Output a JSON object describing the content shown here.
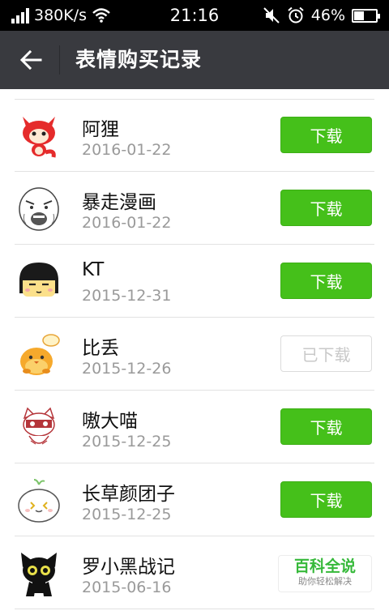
{
  "status_bar": {
    "network_speed": "380K/s",
    "time": "21:16",
    "battery": "46%",
    "battery_level": 0.46,
    "icons": [
      "signal-icon",
      "wifi-icon",
      "mute-icon",
      "alarm-icon",
      "battery-icon"
    ]
  },
  "header": {
    "title": "表情购买记录",
    "back_icon": "back-arrow-icon"
  },
  "items": [
    {
      "name": "阿狸",
      "date": "2016-01-22",
      "button": "下载",
      "downloaded": false,
      "icon": "ali-fox-icon"
    },
    {
      "name": "暴走漫画",
      "date": "2016-01-22",
      "button": "下载",
      "downloaded": false,
      "icon": "rage-face-icon"
    },
    {
      "name": "KT",
      "date": "2015-12-31",
      "button": "下载",
      "downloaded": false,
      "icon": "kt-girl-icon"
    },
    {
      "name": "比丢",
      "date": "2015-12-26",
      "button": "已下载",
      "downloaded": true,
      "icon": "bidiu-chick-icon"
    },
    {
      "name": "嗷大喵",
      "date": "2015-12-25",
      "button": "下载",
      "downloaded": false,
      "icon": "aodamiao-cat-icon"
    },
    {
      "name": "长草颜团子",
      "date": "2015-12-25",
      "button": "下载",
      "downloaded": false,
      "icon": "tuanzi-icon"
    },
    {
      "name": "罗小黑战记",
      "date": "2015-06-16",
      "button": "",
      "downloaded": false,
      "icon": "luoxiaohei-cat-icon"
    }
  ],
  "watermark": {
    "main": "百科全说",
    "sub": "助你轻松解决"
  },
  "colors": {
    "status_bar": "#000000",
    "action_bar": "#393a3f",
    "accent_green": "#45c01a",
    "date_gray": "#9a9a9a"
  }
}
